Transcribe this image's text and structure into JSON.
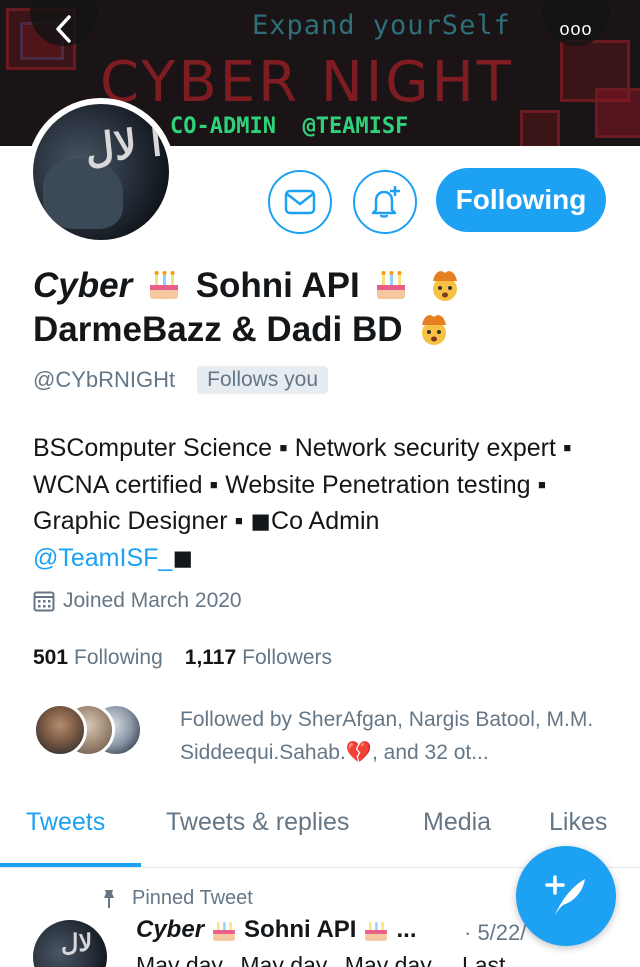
{
  "banner": {
    "tagline": "Expand yourSelf",
    "title": "CYBER NIGHT",
    "subtitle": "CO-ADMIN  @TEAMISF"
  },
  "nav": {
    "back_icon": "chevron-left-icon",
    "more_label": "ooo"
  },
  "actions": {
    "message_icon": "envelope-icon",
    "notify_icon": "bell-plus-icon",
    "follow_label": "Following"
  },
  "profile": {
    "name_part1": "Cyber",
    "name_part2": "Sohni API",
    "name_line2": "DarmeBazz & Dadi BD",
    "handle": "@CYbRNIGHt",
    "follows_you": "Follows you",
    "bio_text": "BSComputer Science  ▪ Network security expert ▪  WCNA certified ▪  Website Penetration testing  ▪ Graphic Designer  ▪  ◼Co Admin",
    "bio_link": "@TeamISF_",
    "bio_link_suffix": "◼",
    "joined": "Joined March 2020",
    "following_count": "501",
    "following_label": "Following",
    "followers_count": "1,117",
    "followers_label": "Followers",
    "followed_by": "Followed by SherAfgan, Nargis Batool, M.M. Siddeequi.Sahab.",
    "followed_by_suffix": ", and 32 ot..."
  },
  "tabs": [
    {
      "label": "Tweets"
    },
    {
      "label": "Tweets & replies"
    },
    {
      "label": "Media"
    },
    {
      "label": "Likes"
    }
  ],
  "tweet": {
    "pinned_label": "Pinned Tweet",
    "author_part1": "Cyber",
    "author_part2": "Sohni API",
    "author_ellipsis": "...",
    "date": "· 5/22/",
    "text": "May day...May day...May day.....Last"
  },
  "colors": {
    "accent": "#1da1f2",
    "secondary_text": "#657786",
    "primary_text": "#14171a"
  }
}
